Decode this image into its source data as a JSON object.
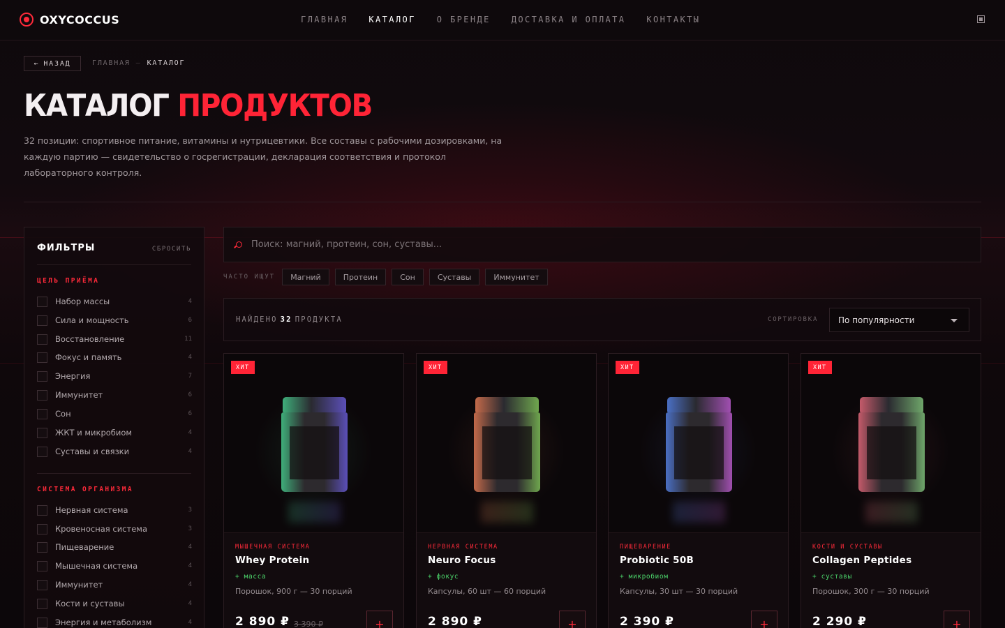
{
  "brand": {
    "name": "OXYCOCCUS",
    "accent": "#ff2436",
    "tag_color": "#4bd36a"
  },
  "nav": [
    {
      "label": "ГЛАВНАЯ"
    },
    {
      "label": "КАТАЛОГ",
      "active": true
    },
    {
      "label": "О БРЕНДЕ"
    },
    {
      "label": "ДОСТАВКА И ОПЛАТА"
    },
    {
      "label": "КОНТАКТЫ"
    }
  ],
  "breadcrumb": {
    "back_label": "НАЗАД",
    "back_arrow": "←",
    "home": "ГЛАВНАЯ",
    "sep": "—",
    "current": "КАТАЛОГ"
  },
  "hero": {
    "title_white": "КАТАЛОГ",
    "title_red": "ПРОДУКТОВ",
    "lead": "32 позиции: спортивное питание, витамины и нутрицевтики. Все составы с рабочими дозировками, на каждую партию — свидетельство о госрегистрации, декларация соответствия и протокол лабораторного контроля."
  },
  "filters": {
    "title": "ФИЛЬТРЫ",
    "reset": "СБРОСИТЬ",
    "groups": [
      {
        "title": "ЦЕЛЬ ПРИЁМА",
        "options": [
          {
            "label": "Набор массы",
            "count": "4"
          },
          {
            "label": "Сила и мощность",
            "count": "6"
          },
          {
            "label": "Восстановление",
            "count": "11"
          },
          {
            "label": "Фокус и память",
            "count": "4"
          },
          {
            "label": "Энергия",
            "count": "7"
          },
          {
            "label": "Иммунитет",
            "count": "6"
          },
          {
            "label": "Сон",
            "count": "6"
          },
          {
            "label": "ЖКТ и микробиом",
            "count": "4"
          },
          {
            "label": "Суставы и связки",
            "count": "4"
          }
        ]
      },
      {
        "title": "СИСТЕМА ОРГАНИЗМА",
        "options": [
          {
            "label": "Нервная система",
            "count": "3"
          },
          {
            "label": "Кровеносная система",
            "count": "3"
          },
          {
            "label": "Пищеварение",
            "count": "4"
          },
          {
            "label": "Мышечная система",
            "count": "4"
          },
          {
            "label": "Иммунитет",
            "count": "4"
          },
          {
            "label": "Кости и суставы",
            "count": "4"
          },
          {
            "label": "Энергия и метаболизм",
            "count": "4"
          }
        ]
      }
    ]
  },
  "search": {
    "placeholder": "Поиск: магний, протеин, сон, суставы..."
  },
  "popular": {
    "label": "ЧАСТО ИЩУТ",
    "chips": [
      "Магний",
      "Протеин",
      "Сон",
      "Суставы",
      "Иммунитет"
    ]
  },
  "results": {
    "found_prefix": "НАЙДЕНО",
    "count": "32",
    "found_suffix": "ПРОДУКТА",
    "sort_label": "СОРТИРОВКА",
    "sort_value": "По популярности"
  },
  "products": [
    {
      "badge": "ХИТ",
      "category": "МЫШЕЧНАЯ СИСТЕМА",
      "name": "Whey Protein",
      "tag": "+ масса",
      "meta": "Порошок, 900 г — 30 порций",
      "price": "2 890 ₽",
      "old_price": "3 390 ₽",
      "colors": [
        "#3fae7a",
        "#5b4fb8"
      ]
    },
    {
      "badge": "ХИТ",
      "category": "НЕРВНАЯ СИСТЕМА",
      "name": "Neuro Focus",
      "tag": "+ фокус",
      "meta": "Капсулы, 60 шт — 60 порций",
      "price": "2 890 ₽",
      "old_price": "",
      "colors": [
        "#c46a4a",
        "#6fa64e"
      ]
    },
    {
      "badge": "ХИТ",
      "category": "ПИЩЕВАРЕНИЕ",
      "name": "Probiotic 50B",
      "tag": "+ микробиом",
      "meta": "Капсулы, 30 шт — 30 порций",
      "price": "2 390 ₽",
      "old_price": "",
      "colors": [
        "#4a6fc4",
        "#a04fb0"
      ]
    },
    {
      "badge": "ХИТ",
      "category": "КОСТИ И СУСТАВЫ",
      "name": "Collagen Peptides",
      "tag": "+ суставы",
      "meta": "Порошок, 300 г — 30 порций",
      "price": "2 290 ₽",
      "old_price": "",
      "colors": [
        "#c45a6a",
        "#6fa66a"
      ]
    }
  ],
  "icons": {
    "logo": "logo-ring-icon",
    "cart": "cart-icon",
    "search": "search-icon",
    "sort": "chevron-down-icon",
    "add": "plus-icon"
  }
}
